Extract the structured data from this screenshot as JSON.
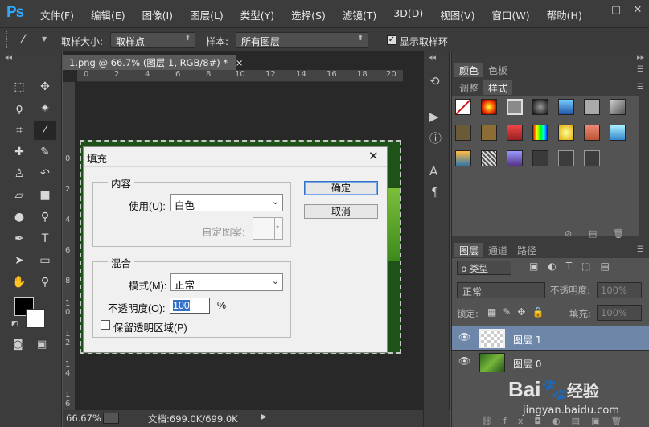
{
  "app": {
    "logo": "Ps",
    "menu": [
      "文件(F)",
      "编辑(E)",
      "图像(I)",
      "图层(L)",
      "类型(Y)",
      "选择(S)",
      "滤镜(T)",
      "3D(D)",
      "视图(V)",
      "窗口(W)",
      "帮助(H)"
    ],
    "window_controls": [
      "—",
      "▢",
      "✕"
    ]
  },
  "options": {
    "sample_size_label": "取样大小:",
    "sample_size_value": "取样点",
    "sample_label": "样本:",
    "sample_value": "所有图层",
    "show_ring_label": "显示取样环"
  },
  "document": {
    "tab_title": "1.png @ 66.7% (图层 1, RGB/8#) *",
    "tab_close": "×",
    "ruler_top": [
      "0",
      "2",
      "4",
      "6",
      "8",
      "10",
      "12",
      "14",
      "16",
      "18",
      "20"
    ],
    "ruler_left": [
      "0",
      "2",
      "4",
      "6",
      "8",
      "1\n0",
      "1\n2",
      "1\n4",
      "1\n6"
    ]
  },
  "status": {
    "zoom": "66.67%",
    "doc": "文档:699.0K/699.0K"
  },
  "dialog": {
    "title": "填充",
    "close": "✕",
    "content_group": "内容",
    "use_label": "使用(U):",
    "use_value": "白色",
    "custom_pattern_label": "自定图案:",
    "blend_group": "混合",
    "mode_label": "模式(M):",
    "mode_value": "正常",
    "opacity_label": "不透明度(O):",
    "opacity_value": "100",
    "opacity_unit": "%",
    "preserve_label": "保留透明区域(P)",
    "ok_label": "确定",
    "cancel_label": "取消"
  },
  "panels": {
    "top_tabs": [
      "颜色",
      "色板"
    ],
    "style_tabs": [
      "调整",
      "样式"
    ],
    "layer_tabs": [
      "图层",
      "通道",
      "路径"
    ],
    "filter_label": "ρ 类型",
    "blend_mode": "正常",
    "opacity_label": "不透明度:",
    "opacity_value": "100%",
    "lock_label": "锁定:",
    "fill_label": "填充:",
    "fill_value": "100%",
    "layers": [
      {
        "name": "图层 1"
      },
      {
        "name": "图层 0"
      }
    ]
  },
  "watermark": {
    "brand": "Bai",
    "brand2": "经验",
    "url": "jingyan.baidu.com"
  },
  "colors": {
    "accent": "#31a8ff",
    "selected_layer": "#6e87a8"
  }
}
